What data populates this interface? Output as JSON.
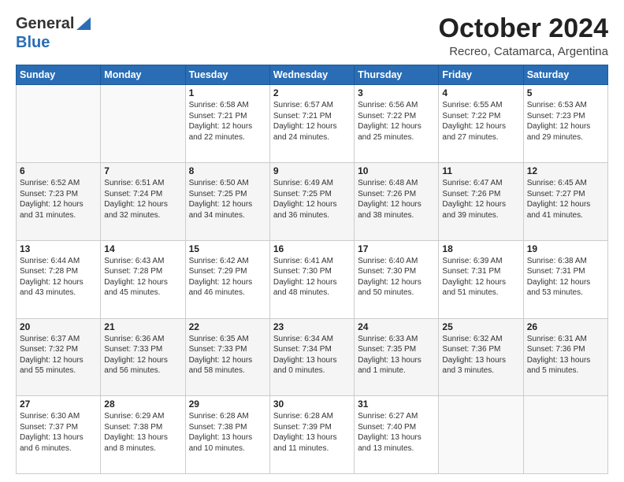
{
  "logo": {
    "general": "General",
    "blue": "Blue"
  },
  "title": {
    "month_year": "October 2024",
    "location": "Recreo, Catamarca, Argentina"
  },
  "weekdays": [
    "Sunday",
    "Monday",
    "Tuesday",
    "Wednesday",
    "Thursday",
    "Friday",
    "Saturday"
  ],
  "weeks": [
    [
      {
        "day": "",
        "info": ""
      },
      {
        "day": "",
        "info": ""
      },
      {
        "day": "1",
        "info": "Sunrise: 6:58 AM\nSunset: 7:21 PM\nDaylight: 12 hours\nand 22 minutes."
      },
      {
        "day": "2",
        "info": "Sunrise: 6:57 AM\nSunset: 7:21 PM\nDaylight: 12 hours\nand 24 minutes."
      },
      {
        "day": "3",
        "info": "Sunrise: 6:56 AM\nSunset: 7:22 PM\nDaylight: 12 hours\nand 25 minutes."
      },
      {
        "day": "4",
        "info": "Sunrise: 6:55 AM\nSunset: 7:22 PM\nDaylight: 12 hours\nand 27 minutes."
      },
      {
        "day": "5",
        "info": "Sunrise: 6:53 AM\nSunset: 7:23 PM\nDaylight: 12 hours\nand 29 minutes."
      }
    ],
    [
      {
        "day": "6",
        "info": "Sunrise: 6:52 AM\nSunset: 7:23 PM\nDaylight: 12 hours\nand 31 minutes."
      },
      {
        "day": "7",
        "info": "Sunrise: 6:51 AM\nSunset: 7:24 PM\nDaylight: 12 hours\nand 32 minutes."
      },
      {
        "day": "8",
        "info": "Sunrise: 6:50 AM\nSunset: 7:25 PM\nDaylight: 12 hours\nand 34 minutes."
      },
      {
        "day": "9",
        "info": "Sunrise: 6:49 AM\nSunset: 7:25 PM\nDaylight: 12 hours\nand 36 minutes."
      },
      {
        "day": "10",
        "info": "Sunrise: 6:48 AM\nSunset: 7:26 PM\nDaylight: 12 hours\nand 38 minutes."
      },
      {
        "day": "11",
        "info": "Sunrise: 6:47 AM\nSunset: 7:26 PM\nDaylight: 12 hours\nand 39 minutes."
      },
      {
        "day": "12",
        "info": "Sunrise: 6:45 AM\nSunset: 7:27 PM\nDaylight: 12 hours\nand 41 minutes."
      }
    ],
    [
      {
        "day": "13",
        "info": "Sunrise: 6:44 AM\nSunset: 7:28 PM\nDaylight: 12 hours\nand 43 minutes."
      },
      {
        "day": "14",
        "info": "Sunrise: 6:43 AM\nSunset: 7:28 PM\nDaylight: 12 hours\nand 45 minutes."
      },
      {
        "day": "15",
        "info": "Sunrise: 6:42 AM\nSunset: 7:29 PM\nDaylight: 12 hours\nand 46 minutes."
      },
      {
        "day": "16",
        "info": "Sunrise: 6:41 AM\nSunset: 7:30 PM\nDaylight: 12 hours\nand 48 minutes."
      },
      {
        "day": "17",
        "info": "Sunrise: 6:40 AM\nSunset: 7:30 PM\nDaylight: 12 hours\nand 50 minutes."
      },
      {
        "day": "18",
        "info": "Sunrise: 6:39 AM\nSunset: 7:31 PM\nDaylight: 12 hours\nand 51 minutes."
      },
      {
        "day": "19",
        "info": "Sunrise: 6:38 AM\nSunset: 7:31 PM\nDaylight: 12 hours\nand 53 minutes."
      }
    ],
    [
      {
        "day": "20",
        "info": "Sunrise: 6:37 AM\nSunset: 7:32 PM\nDaylight: 12 hours\nand 55 minutes."
      },
      {
        "day": "21",
        "info": "Sunrise: 6:36 AM\nSunset: 7:33 PM\nDaylight: 12 hours\nand 56 minutes."
      },
      {
        "day": "22",
        "info": "Sunrise: 6:35 AM\nSunset: 7:33 PM\nDaylight: 12 hours\nand 58 minutes."
      },
      {
        "day": "23",
        "info": "Sunrise: 6:34 AM\nSunset: 7:34 PM\nDaylight: 13 hours\nand 0 minutes."
      },
      {
        "day": "24",
        "info": "Sunrise: 6:33 AM\nSunset: 7:35 PM\nDaylight: 13 hours\nand 1 minute."
      },
      {
        "day": "25",
        "info": "Sunrise: 6:32 AM\nSunset: 7:36 PM\nDaylight: 13 hours\nand 3 minutes."
      },
      {
        "day": "26",
        "info": "Sunrise: 6:31 AM\nSunset: 7:36 PM\nDaylight: 13 hours\nand 5 minutes."
      }
    ],
    [
      {
        "day": "27",
        "info": "Sunrise: 6:30 AM\nSunset: 7:37 PM\nDaylight: 13 hours\nand 6 minutes."
      },
      {
        "day": "28",
        "info": "Sunrise: 6:29 AM\nSunset: 7:38 PM\nDaylight: 13 hours\nand 8 minutes."
      },
      {
        "day": "29",
        "info": "Sunrise: 6:28 AM\nSunset: 7:38 PM\nDaylight: 13 hours\nand 10 minutes."
      },
      {
        "day": "30",
        "info": "Sunrise: 6:28 AM\nSunset: 7:39 PM\nDaylight: 13 hours\nand 11 minutes."
      },
      {
        "day": "31",
        "info": "Sunrise: 6:27 AM\nSunset: 7:40 PM\nDaylight: 13 hours\nand 13 minutes."
      },
      {
        "day": "",
        "info": ""
      },
      {
        "day": "",
        "info": ""
      }
    ]
  ]
}
